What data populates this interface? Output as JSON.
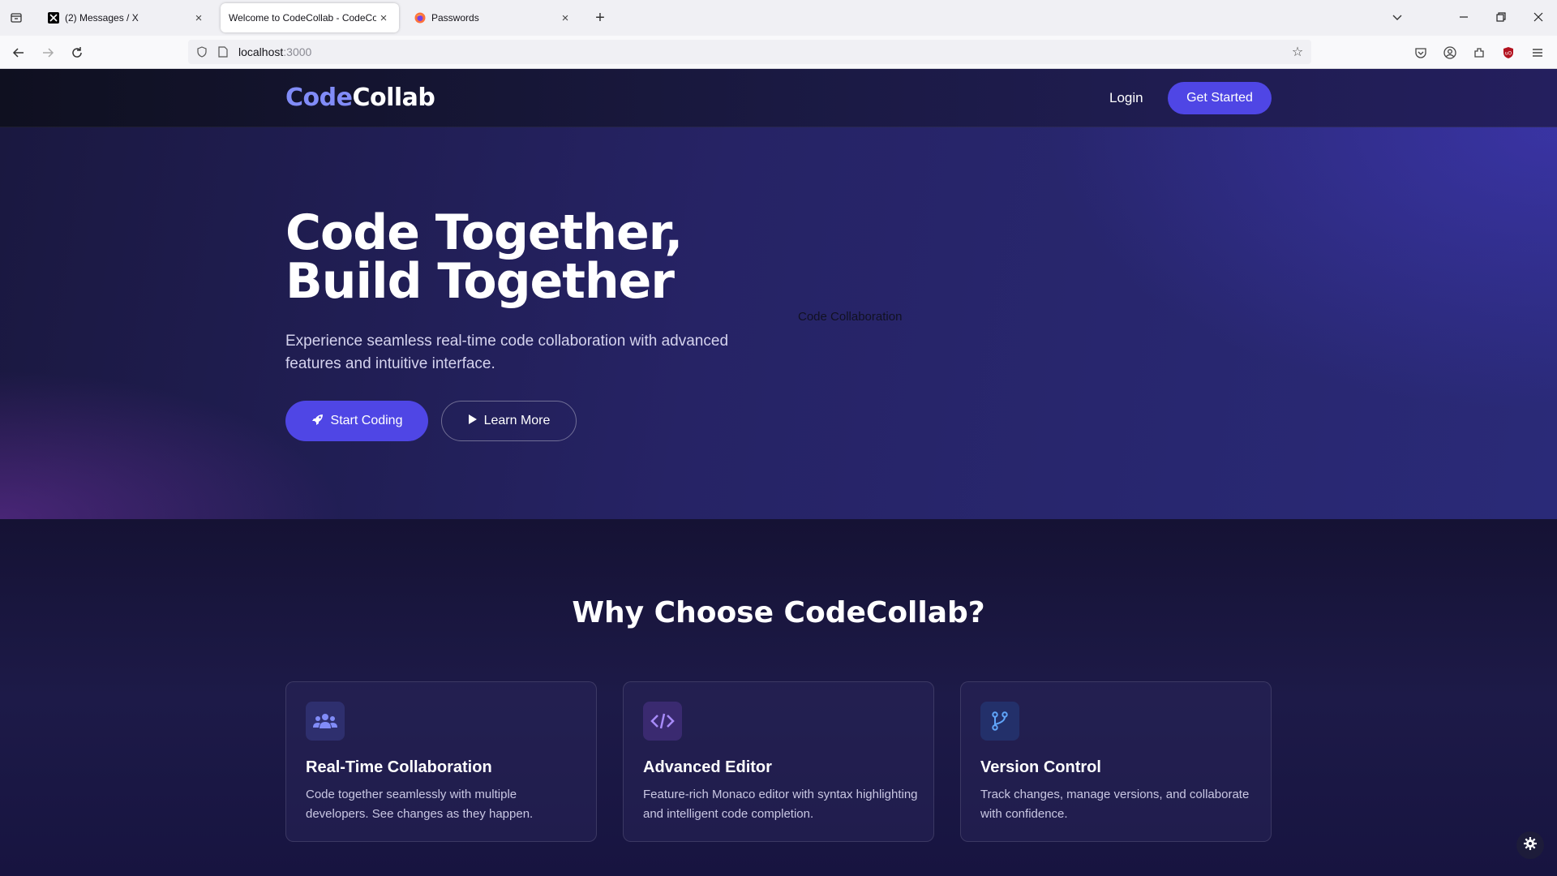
{
  "browser": {
    "tabs": [
      {
        "title": "(2) Messages / X",
        "favicon": "x-logo-icon"
      },
      {
        "title": "Welcome to CodeCollab - CodeCollab",
        "favicon": "none"
      },
      {
        "title": "Passwords",
        "favicon": "firefox-icon"
      }
    ],
    "active_tab": 1,
    "url_host": "localhost",
    "url_port": ":3000"
  },
  "site": {
    "logo_part1": "Code",
    "logo_part2": "Collab",
    "nav_login": "Login",
    "nav_get_started": "Get Started"
  },
  "hero": {
    "title_line1": "Code Together,",
    "title_line2": "Build Together",
    "subtitle": "Experience seamless real-time code collaboration with advanced features and intuitive interface.",
    "image_alt": "Code Collaboration",
    "btn_start": "Start Coding",
    "btn_learn": "Learn More"
  },
  "features": {
    "heading": "Why Choose CodeCollab?",
    "cards": [
      {
        "title": "Real-Time Collaboration",
        "text": "Code together seamlessly with multiple developers. See changes as they happen.",
        "icon": "users-icon"
      },
      {
        "title": "Advanced Editor",
        "text": "Feature-rich Monaco editor with syntax highlighting and intelligent code completion.",
        "icon": "code-icon"
      },
      {
        "title": "Version Control",
        "text": "Track changes, manage versions, and collaborate with confidence.",
        "icon": "git-branch-icon"
      }
    ]
  },
  "colors": {
    "accent": "#4f46e5",
    "logo_accent": "#818cf8"
  }
}
